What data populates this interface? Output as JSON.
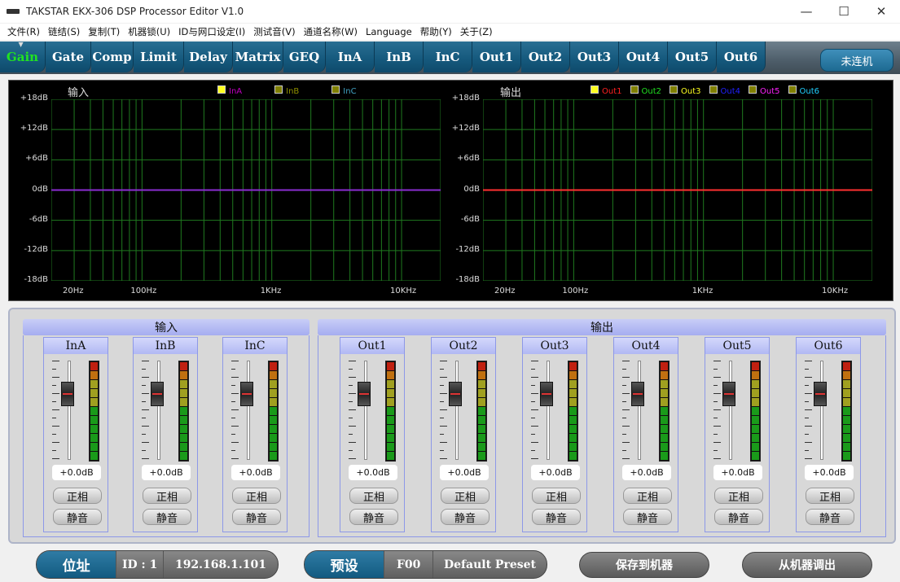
{
  "window": {
    "title": "TAKSTAR EKX-306 DSP Processor Editor V1.0",
    "minimize": "—",
    "maximize": "☐",
    "close": "✕"
  },
  "menu": [
    "文件(R)",
    "链结(S)",
    "复制(T)",
    "机器锁(U)",
    "ID与网口设定(I)",
    "测试音(V)",
    "通道名称(W)",
    "Language",
    "帮助(Y)",
    "关于(Z)"
  ],
  "tabs": [
    {
      "label": "Gain",
      "active": true
    },
    {
      "label": "Gate"
    },
    {
      "label": "Comp"
    },
    {
      "label": "Limit"
    },
    {
      "label": "Delay"
    },
    {
      "label": "Matrix"
    },
    {
      "label": "GEQ"
    },
    {
      "label": "InA"
    },
    {
      "label": "InB"
    },
    {
      "label": "InC"
    },
    {
      "label": "Out1"
    },
    {
      "label": "Out2"
    },
    {
      "label": "Out3"
    },
    {
      "label": "Out4"
    },
    {
      "label": "Out5"
    },
    {
      "label": "Out6"
    }
  ],
  "connect_button": "未连机",
  "graphs": {
    "input": {
      "title": "输入",
      "legend": [
        {
          "name": "InA",
          "color": "#c000c0"
        },
        {
          "name": "InB",
          "color": "#909000"
        },
        {
          "name": "InC",
          "color": "#40a0c0"
        }
      ],
      "line_color": "#8a2ed0"
    },
    "output": {
      "title": "输出",
      "legend": [
        {
          "name": "Out1",
          "color": "#ff2020"
        },
        {
          "name": "Out2",
          "color": "#20e020"
        },
        {
          "name": "Out3",
          "color": "#ffff20"
        },
        {
          "name": "Out4",
          "color": "#2020ff"
        },
        {
          "name": "Out5",
          "color": "#ff20ff"
        },
        {
          "name": "Out6",
          "color": "#20d0ff"
        }
      ],
      "line_color": "#ff3030"
    },
    "y_labels": [
      "+18dB",
      "+12dB",
      "+6dB",
      "0dB",
      "-6dB",
      "-12dB",
      "-18dB"
    ],
    "x_labels": [
      "20Hz",
      "100Hz",
      "1KHz",
      "10KHz"
    ]
  },
  "mixer": {
    "input_header": "输入",
    "output_header": "输出",
    "channels": [
      {
        "name": "InA",
        "gain": "+0.0dB",
        "phase": "正相",
        "mute": "静音"
      },
      {
        "name": "InB",
        "gain": "+0.0dB",
        "phase": "正相",
        "mute": "静音"
      },
      {
        "name": "InC",
        "gain": "+0.0dB",
        "phase": "正相",
        "mute": "静音"
      },
      {
        "name": "Out1",
        "gain": "+0.0dB",
        "phase": "正相",
        "mute": "静音"
      },
      {
        "name": "Out2",
        "gain": "+0.0dB",
        "phase": "正相",
        "mute": "静音"
      },
      {
        "name": "Out3",
        "gain": "+0.0dB",
        "phase": "正相",
        "mute": "静音"
      },
      {
        "name": "Out4",
        "gain": "+0.0dB",
        "phase": "正相",
        "mute": "静音"
      },
      {
        "name": "Out5",
        "gain": "+0.0dB",
        "phase": "正相",
        "mute": "静音"
      },
      {
        "name": "Out6",
        "gain": "+0.0dB",
        "phase": "正相",
        "mute": "静音"
      }
    ]
  },
  "bottom": {
    "address_label": "位址",
    "id": "ID : 1",
    "ip": "192.168.1.101",
    "preset_label": "预设",
    "preset_code": "F00",
    "preset_name": "Default Preset",
    "save_button": "保存到机器",
    "load_button": "从机器调出"
  }
}
